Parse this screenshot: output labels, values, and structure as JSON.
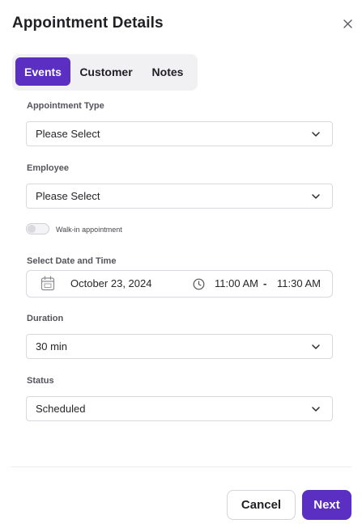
{
  "dialog": {
    "title": "Appointment Details"
  },
  "tabs": [
    {
      "label": "Events",
      "active": true
    },
    {
      "label": "Customer",
      "active": false
    },
    {
      "label": "Notes",
      "active": false
    }
  ],
  "form": {
    "appointment_type": {
      "label": "Appointment Type",
      "value": "Please Select"
    },
    "employee": {
      "label": "Employee",
      "value": "Please Select"
    },
    "walk_in": {
      "label": "Walk-in appointment",
      "checked": false
    },
    "date_time": {
      "label": "Select Date and Time",
      "date": "October 23, 2024",
      "start": "11:00 AM",
      "separator": "-",
      "end": "11:30 AM"
    },
    "duration": {
      "label": "Duration",
      "value": "30 min"
    },
    "status": {
      "label": "Status",
      "value": "Scheduled"
    }
  },
  "footer": {
    "cancel_label": "Cancel",
    "next_label": "Next"
  },
  "colors": {
    "accent": "#5a2fc2",
    "tab_bg": "#f1f1f4",
    "border": "#d8d8de"
  },
  "icons": [
    "close-icon",
    "chevron-down-icon",
    "calendar-icon",
    "clock-icon"
  ]
}
